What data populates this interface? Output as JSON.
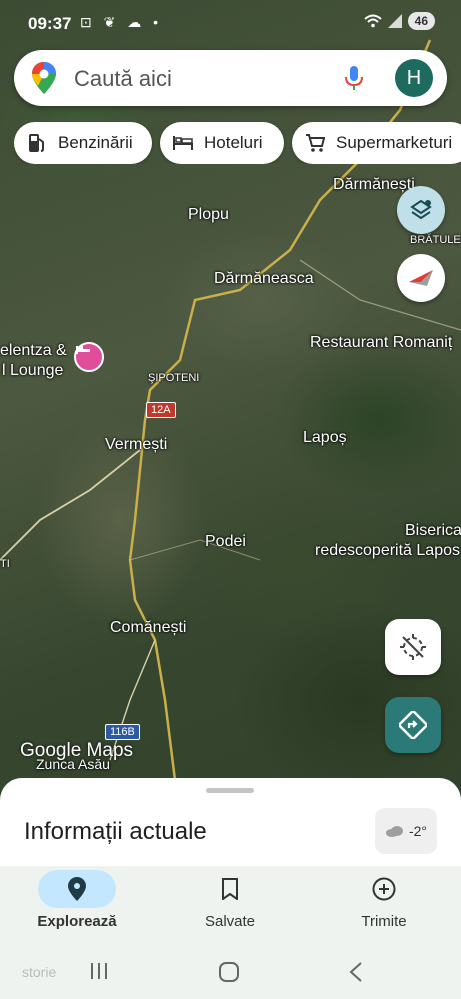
{
  "status": {
    "time": "09:37",
    "battery": "46"
  },
  "search": {
    "placeholder": "Caută aici",
    "avatar_letter": "H"
  },
  "chips": [
    {
      "label": "Benzinării",
      "icon": "gas-station-icon"
    },
    {
      "label": "Hoteluri",
      "icon": "bed-icon"
    },
    {
      "label": "Supermarketuri",
      "icon": "cart-icon"
    }
  ],
  "map_labels": {
    "darmanesti": "Dărmănești",
    "bratule": "BRĂTULE",
    "plopu": "Plopu",
    "darmaneasca": "Dărmăneasca",
    "hotel_line1": "elentza &",
    "hotel_line2": "l Lounge",
    "restaurant": "Restaurant Romaniț",
    "sipoteni": "ŞIPOTENI",
    "vermesti": "Vermești",
    "lapos": "Lapoș",
    "biserica_line1": "Biserica",
    "biserica_line2": "redescoperită Lapos",
    "podei": "Podei",
    "comanesti": "Comănești",
    "zunca": "Zunca Asău",
    "edge_small": "TI",
    "road_12a": "12A",
    "road_116b": "116B",
    "google_maps": "Google Maps"
  },
  "sheet": {
    "title": "Informații actuale",
    "weather": "-2°"
  },
  "nav": {
    "explore": "Explorează",
    "saved": "Salvate",
    "contribute": "Trimite"
  },
  "system_label": "storie",
  "colors": {
    "accent": "#1d6b5e",
    "nav_active": "#c2e7ff",
    "directions": "#2b7a78",
    "hotel_pin": "#e04e9a"
  }
}
